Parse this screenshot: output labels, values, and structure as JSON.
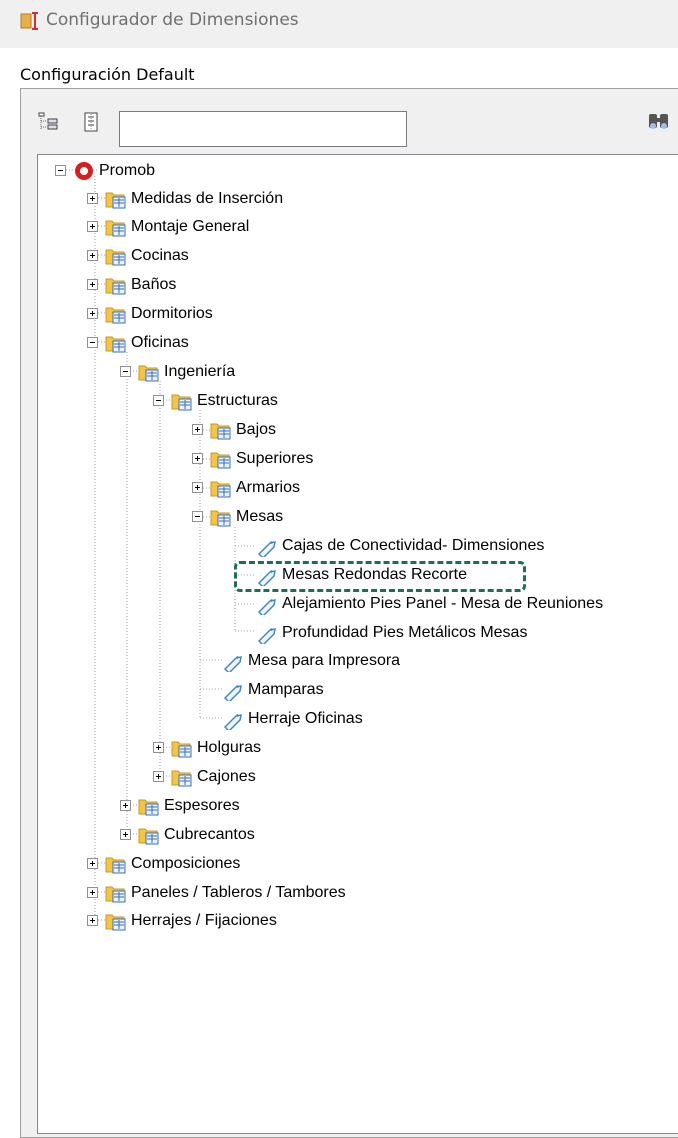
{
  "window": {
    "title": "Configurador de Dimensiones"
  },
  "panel": {
    "title": "Configuración Default"
  },
  "search": {
    "value": "",
    "placeholder": ""
  },
  "tree": {
    "root": "Promob",
    "items": {
      "medidas": "Medidas de Inserción",
      "montaje": "Montaje General",
      "cocinas": "Cocinas",
      "banos": "Baños",
      "dormitorios": "Dormitorios",
      "oficinas": "Oficinas",
      "ingenieria": "Ingeniería",
      "estructuras": "Estructuras",
      "bajos": "Bajos",
      "superiores": "Superiores",
      "armarios": "Armarios",
      "mesas": "Mesas",
      "cajas": "Cajas de Conectividad- Dimensiones",
      "mesas_redondas": "Mesas Redondas Recorte",
      "alejamiento": "Alejamiento Pies Panel - Mesa de Reuniones",
      "profundidad": "Profundidad Pies Metálicos Mesas",
      "mesa_impresora": "Mesa para Impresora",
      "mamparas": "Mamparas",
      "herraje_oficinas": "Herraje Oficinas",
      "holguras": "Holguras",
      "cajones": "Cajones",
      "espesores": "Espesores",
      "cubrecantos": "Cubrecantos",
      "composiciones": "Composiciones",
      "paneles": "Paneles / Tableros / Tambores",
      "herrajes": "Herrajes / Fijaciones"
    }
  },
  "colors": {
    "highlight_border": "#1f6e4f",
    "folder": "#f4c542",
    "tag": "#3a82c4"
  }
}
